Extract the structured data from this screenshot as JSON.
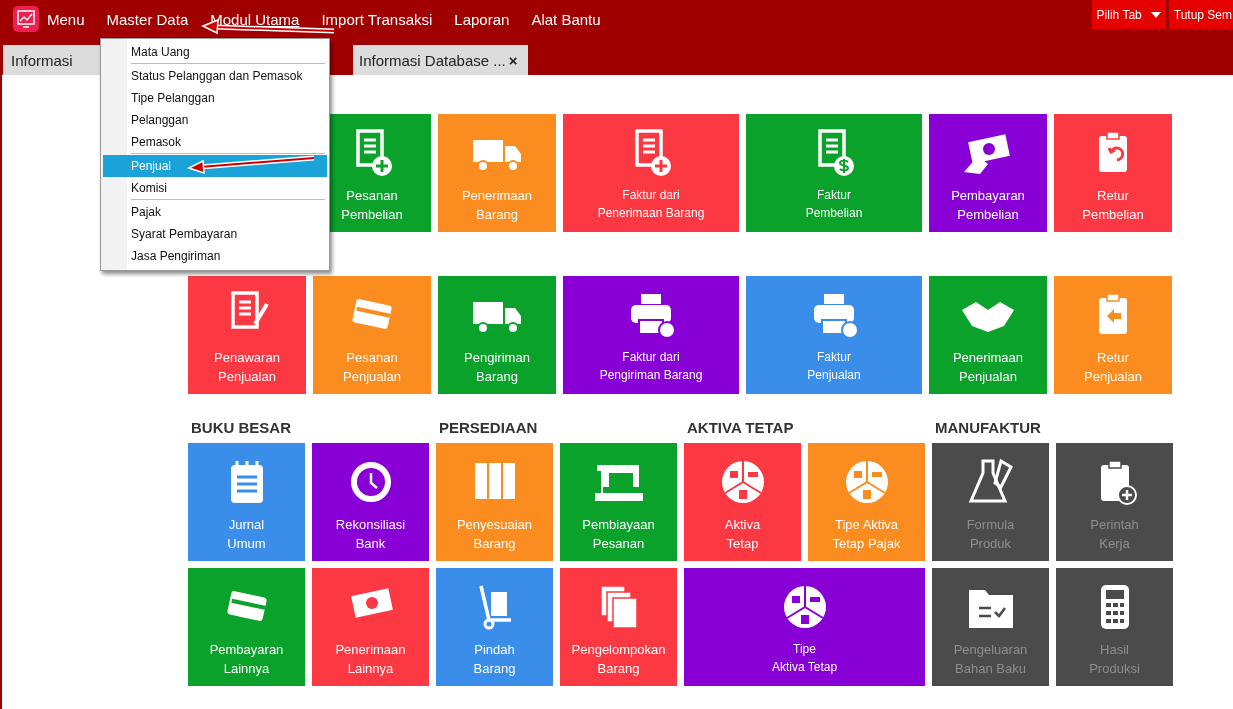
{
  "menu_bar": {
    "items": [
      {
        "label": "Menu",
        "hovered": false
      },
      {
        "label": "Master Data",
        "hovered": false
      },
      {
        "label": "Modul Utama",
        "hovered": true
      },
      {
        "label": "Import Transaksi",
        "hovered": false
      },
      {
        "label": "Laporan",
        "hovered": false
      },
      {
        "label": "Alat Bantu",
        "hovered": false
      }
    ],
    "right_buttons": [
      {
        "label": "Pilih Tab",
        "kind": "dropdown"
      },
      {
        "label": "Tutup Sem",
        "kind": "plain"
      }
    ]
  },
  "tabs": [
    {
      "label": "Informasi"
    },
    {
      "label": "Informasi Database ...",
      "close": "×"
    }
  ],
  "dropdown": {
    "items": [
      {
        "label": "Mata Uang",
        "selected": false,
        "separator_after": true
      },
      {
        "label": "Status Pelanggan dan Pemasok",
        "selected": false,
        "separator_after": false
      },
      {
        "label": "Tipe Pelanggan",
        "selected": false,
        "separator_after": false
      },
      {
        "label": "Pelanggan",
        "selected": false,
        "separator_after": false
      },
      {
        "label": "Pemasok",
        "selected": false,
        "separator_after": true
      },
      {
        "label": "Penjual",
        "selected": true,
        "separator_after": false
      },
      {
        "label": "Komisi",
        "selected": false,
        "separator_after": true
      },
      {
        "label": "Pajak",
        "selected": false,
        "separator_after": false
      },
      {
        "label": "Syarat Pembayaran",
        "selected": false,
        "separator_after": false
      },
      {
        "label": "Jasa Pengiriman",
        "selected": false,
        "separator_after": false
      }
    ]
  },
  "tile_rows": [
    {
      "tiles": [
        {
          "lines": [
            "Pesanan",
            "Pembelian"
          ],
          "color": "#0ba22b",
          "wide": false,
          "disabled": false
        },
        {
          "lines": [
            "Penerimaan",
            "Barang"
          ],
          "color": "#fb8c1f",
          "wide": false,
          "disabled": false
        },
        {
          "lines": [
            "Faktur dari",
            "Penerimaan Barang"
          ],
          "color": "#fc3843",
          "wide": true,
          "disabled": false
        },
        {
          "lines": [
            "Faktur",
            "Pembelian"
          ],
          "color": "#0ba22b",
          "wide": true,
          "disabled": false
        },
        {
          "lines": [
            "Pembayaran",
            "Pembelian"
          ],
          "color": "#8800d6",
          "wide": false,
          "disabled": false
        },
        {
          "lines": [
            "Retur",
            "Pembelian"
          ],
          "color": "#fc3843",
          "wide": false,
          "disabled": false
        }
      ]
    },
    {
      "tiles": [
        {
          "lines": [
            "Penawaran",
            "Penjualan"
          ],
          "color": "#fc3843",
          "wide": false,
          "disabled": false
        },
        {
          "lines": [
            "Pesanan",
            "Penjualan"
          ],
          "color": "#fb8c1f",
          "wide": false,
          "disabled": false
        },
        {
          "lines": [
            "Pengiriman",
            "Barang"
          ],
          "color": "#0ba22b",
          "wide": false,
          "disabled": false
        },
        {
          "lines": [
            "Faktur dari",
            "Pengiriman Barang"
          ],
          "color": "#8800d6",
          "wide": true,
          "disabled": false
        },
        {
          "lines": [
            "Faktur",
            "Penjualan"
          ],
          "color": "#3a8de8",
          "wide": true,
          "disabled": false
        },
        {
          "lines": [
            "Penerimaan",
            "Penjualan"
          ],
          "color": "#0ba22b",
          "wide": false,
          "disabled": false
        },
        {
          "lines": [
            "Retur",
            "Penjualan"
          ],
          "color": "#fb8c1f",
          "wide": false,
          "disabled": false
        }
      ]
    }
  ],
  "sections": [
    {
      "heading": "BUKU BESAR",
      "tiles": [
        {
          "lines": [
            "Jurnal",
            "Umum"
          ],
          "color": "#3a8de8",
          "wide": false,
          "disabled": false
        },
        {
          "lines": [
            "Rekonsiliasi",
            "Bank"
          ],
          "color": "#8800d6",
          "wide": false,
          "disabled": false
        },
        {
          "lines": [
            "Pembayaran",
            "Lainnya"
          ],
          "color": "#0ba22b",
          "wide": false,
          "disabled": false
        },
        {
          "lines": [
            "Penerimaan",
            "Lainnya"
          ],
          "color": "#fc3843",
          "wide": false,
          "disabled": false
        }
      ]
    },
    {
      "heading": "PERSEDIAAN",
      "tiles": [
        {
          "lines": [
            "Penyesuaian",
            "Barang"
          ],
          "color": "#fb8c1f",
          "wide": false,
          "disabled": false
        },
        {
          "lines": [
            "Pembiayaan",
            "Pesanan"
          ],
          "color": "#0ba22b",
          "wide": false,
          "disabled": false
        },
        {
          "lines": [
            "Pindah",
            "Barang"
          ],
          "color": "#3a8de8",
          "wide": false,
          "disabled": false
        },
        {
          "lines": [
            "Pengelompokan",
            "Barang"
          ],
          "color": "#fc3843",
          "wide": false,
          "disabled": false
        }
      ]
    },
    {
      "heading": "AKTIVA TETAP",
      "tiles": [
        {
          "lines": [
            "Aktiva",
            "Tetap"
          ],
          "color": "#fc3843",
          "wide": false,
          "disabled": false
        },
        {
          "lines": [
            "Tipe Aktiva",
            "Tetap Pajak"
          ],
          "color": "#fb8c1f",
          "wide": false,
          "disabled": false
        },
        {
          "lines": [
            "Tipe",
            "Aktiva Tetap"
          ],
          "color": "#8800d6",
          "wide": true,
          "disabled": false
        }
      ]
    },
    {
      "heading": "MANUFAKTUR",
      "tiles": [
        {
          "lines": [
            "Formula",
            "Produk"
          ],
          "color": "#4b4b4b",
          "wide": false,
          "disabled": true
        },
        {
          "lines": [
            "Perintah",
            "Kerja"
          ],
          "color": "#4b4b4b",
          "wide": false,
          "disabled": true
        },
        {
          "lines": [
            "Pengeluaran",
            "Bahan Baku"
          ],
          "color": "#4b4b4b",
          "wide": false,
          "disabled": true
        },
        {
          "lines": [
            "Hasil",
            "Produksi"
          ],
          "color": "#4b4b4b",
          "wide": false,
          "disabled": true
        }
      ]
    }
  ]
}
